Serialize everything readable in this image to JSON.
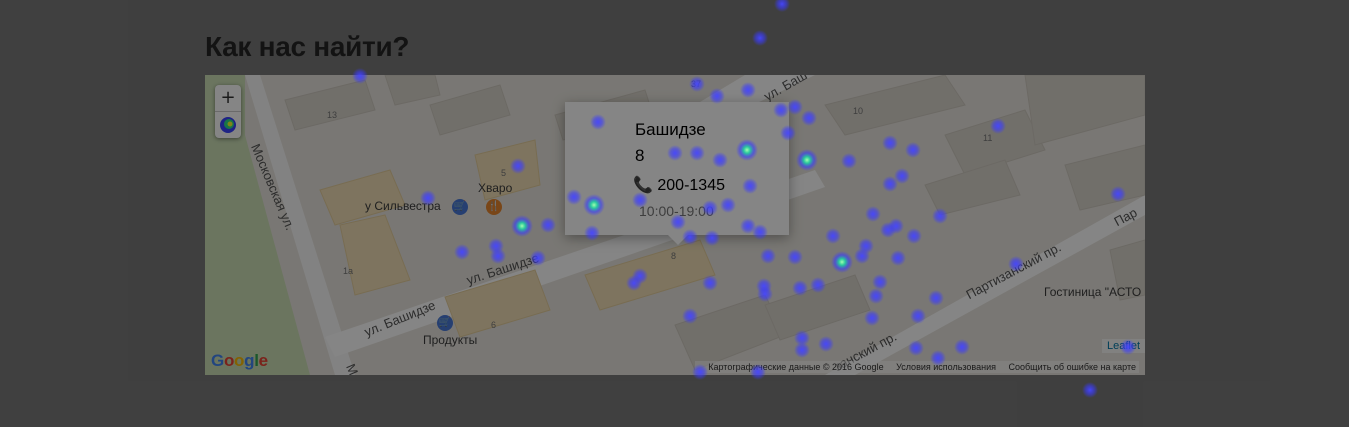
{
  "page": {
    "title": "Как нас найти?"
  },
  "map": {
    "streets": {
      "moskovskaya": "Московская ул.",
      "moskovskaya_cut": "М",
      "bashidze_1": "ул. Башидзе",
      "bashidze_2": "ул. Башидзе",
      "bashidze_top": "ул. Баш",
      "partizansky_1": "Партизанский пр.",
      "partizansky_2": "занский пр.",
      "partizansky_cut": "Пар"
    },
    "pois": {
      "silvestra": "у Сильвестра",
      "hvaro": "Хварο",
      "produkty": "Продукты",
      "hotel": "Гостиница \"АСТО"
    },
    "building_numbers": [
      "13",
      "37",
      "10",
      "11",
      "5",
      "1a",
      "6",
      "8"
    ],
    "zoom": {
      "in": "+",
      "out": "−"
    },
    "google_logo": "Google",
    "attribution": {
      "data": "Картографические данные © 2016 Google",
      "terms": "Условия использования",
      "report": "Сообщить об ошибке на карте"
    },
    "leaflet": "Leaflet",
    "popup": {
      "street": "Башидзе",
      "number": "8",
      "phone": "200-1345",
      "hours": "10:00-19:00"
    }
  },
  "colors": {
    "overlay": "#000000",
    "heat_core": "#3c3cff",
    "heat_hot": "#00e0a0"
  },
  "icons": [
    "phone-icon",
    "cart-icon",
    "fork-knife-icon",
    "heatmap-toggle-icon"
  ]
}
